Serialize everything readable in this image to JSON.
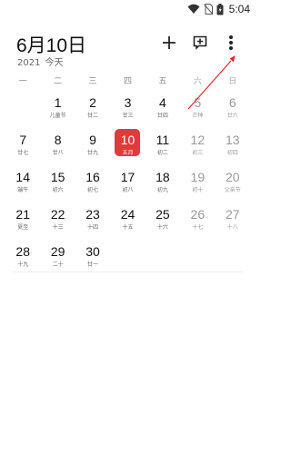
{
  "status_bar": {
    "time": "5:04"
  },
  "header": {
    "title": "6月10日",
    "year": "2021",
    "today_label": "今天"
  },
  "weekdays": [
    "一",
    "二",
    "三",
    "四",
    "五",
    "六",
    "日"
  ],
  "weeks": [
    [
      {
        "day": "",
        "lunar": ""
      },
      {
        "day": "1",
        "lunar": "儿童节"
      },
      {
        "day": "2",
        "lunar": "廿二"
      },
      {
        "day": "3",
        "lunar": "廿三"
      },
      {
        "day": "4",
        "lunar": "廿四"
      },
      {
        "day": "5",
        "lunar": "芒种"
      },
      {
        "day": "6",
        "lunar": "廿六"
      }
    ],
    [
      {
        "day": "7",
        "lunar": "廿七"
      },
      {
        "day": "8",
        "lunar": "廿八"
      },
      {
        "day": "9",
        "lunar": "廿九"
      },
      {
        "day": "10",
        "lunar": "五月"
      },
      {
        "day": "11",
        "lunar": "初二"
      },
      {
        "day": "12",
        "lunar": "初三"
      },
      {
        "day": "13",
        "lunar": "初四"
      }
    ],
    [
      {
        "day": "14",
        "lunar": "端午"
      },
      {
        "day": "15",
        "lunar": "初六"
      },
      {
        "day": "16",
        "lunar": "初七"
      },
      {
        "day": "17",
        "lunar": "初八"
      },
      {
        "day": "18",
        "lunar": "初九"
      },
      {
        "day": "19",
        "lunar": "初十"
      },
      {
        "day": "20",
        "lunar": "父亲节"
      }
    ],
    [
      {
        "day": "21",
        "lunar": "夏至"
      },
      {
        "day": "22",
        "lunar": "十三"
      },
      {
        "day": "23",
        "lunar": "十四"
      },
      {
        "day": "24",
        "lunar": "十五"
      },
      {
        "day": "25",
        "lunar": "十六"
      },
      {
        "day": "26",
        "lunar": "十七"
      },
      {
        "day": "27",
        "lunar": "十八"
      }
    ],
    [
      {
        "day": "28",
        "lunar": "十九"
      },
      {
        "day": "29",
        "lunar": "二十"
      },
      {
        "day": "30",
        "lunar": "廿一"
      },
      {
        "day": "",
        "lunar": ""
      },
      {
        "day": "",
        "lunar": ""
      },
      {
        "day": "",
        "lunar": ""
      },
      {
        "day": "",
        "lunar": ""
      }
    ]
  ],
  "selected_day": "10",
  "colors": {
    "accent": "#e23a3a",
    "weekend": "#999999",
    "annotation": "#e0262b"
  },
  "icons": {
    "add": "plus-icon",
    "new_event": "add-box-icon",
    "more": "more-vert-icon"
  }
}
